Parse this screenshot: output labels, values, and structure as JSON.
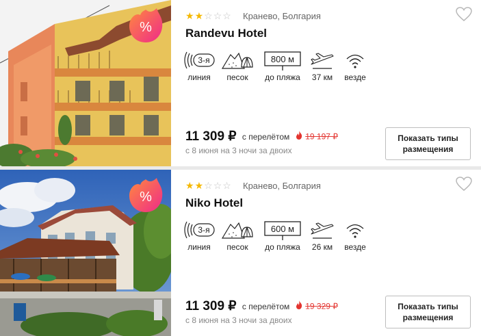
{
  "hotels": [
    {
      "rating_stars": 2,
      "location": "Кранево, Болгария",
      "name": "Randevu Hotel",
      "amenities": [
        {
          "icon": "line-waves-icon",
          "badge": "3-я",
          "label": "линия"
        },
        {
          "icon": "sand-shell-icon",
          "label": "песок"
        },
        {
          "icon": "sign-board-icon",
          "badge": "800 м",
          "label": "до пляжа"
        },
        {
          "icon": "airplane-icon",
          "label": "37 км"
        },
        {
          "icon": "wifi-icon",
          "label": "везде"
        }
      ],
      "price": "11 309 ₽",
      "price_note": "с перелётом",
      "old_price": "19 197 ₽",
      "dates": "с 8 июня на 3 ночи за двоих",
      "button": "Показать типы размещения",
      "promo_symbol": "%"
    },
    {
      "rating_stars": 2,
      "location": "Кранево, Болгария",
      "name": "Niko Hotel",
      "amenities": [
        {
          "icon": "line-waves-icon",
          "badge": "3-я",
          "label": "линия"
        },
        {
          "icon": "sand-shell-icon",
          "label": "песок"
        },
        {
          "icon": "sign-board-icon",
          "badge": "600 м",
          "label": "до пляжа"
        },
        {
          "icon": "airplane-icon",
          "label": "26 км"
        },
        {
          "icon": "wifi-icon",
          "label": "везде"
        }
      ],
      "price": "11 309 ₽",
      "price_note": "с перелётом",
      "old_price": "19 329 ₽",
      "dates": "с 8 июня на 3 ночи за двоих",
      "button": "Показать типы размещения",
      "promo_symbol": "%"
    }
  ],
  "colors": {
    "star": "#f5b800",
    "old_price": "#e3342f",
    "promo_start": "#ff8a3d",
    "promo_end": "#ef2a8a"
  }
}
